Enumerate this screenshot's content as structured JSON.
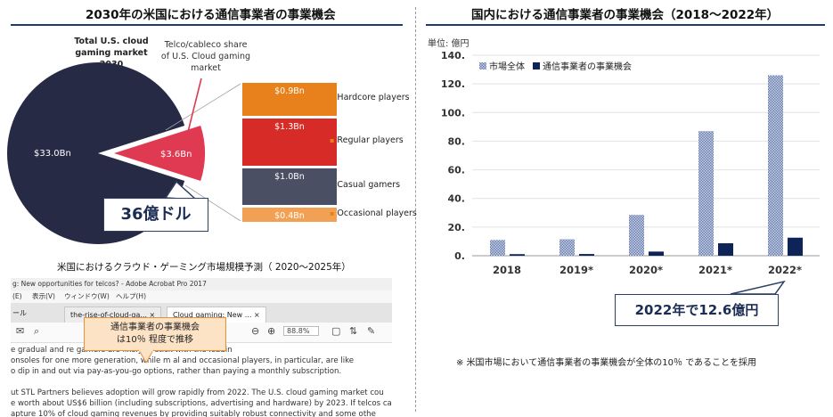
{
  "left_panel": {
    "title": "2030年の米国における通信事業者の事業機会",
    "pie_header_line1": "Total U.S. cloud",
    "pie_header_line2": "gaming market 2030",
    "share_label_line1": "Telco/cableco share",
    "share_label_line2": "of U.S. Cloud gaming",
    "share_label_line3": "market",
    "callout": "36億ドル"
  },
  "screenshot": {
    "title_bar": "g: New opportunities for telcos? - Adobe Acrobat Pro 2017",
    "menu": [
      "(E)",
      "表示(V)",
      "ウィンドウ(W)",
      "ヘルプ(H)"
    ],
    "tab_left": "ール",
    "tabs": [
      "the-rise-of-cloud-ga...",
      "Cloud gaming: New ..."
    ],
    "zoom": "88.8%",
    "body_lines": [
      "e gradual and                                    re gamers are likely to stick with the leadin",
      "onsoles for one more generation, while m          al and occasional players, in particular, are like",
      "o dip in and out via pay-as-you-go options, rather than paying a monthly subscription.",
      "",
      "ut STL Partners believes adoption will grow rapidly from 2022. The U.S. cloud gaming market cou",
      "e worth about US$6 billion (including subscriptions, advertising and hardware) by 2023. If telcos ca",
      "apture 10% of cloud gaming revenues by providing suitably robust connectivity and some othe"
    ],
    "caption": "米国におけるクラウド・ゲーミング市場規模予測（ 2020～2025年）",
    "orange_callout_line1": "通信事業者の事業機会",
    "orange_callout_line2": "は10％ 程度で推移"
  },
  "right_panel": {
    "title": "国内における通信事業者の事業機会（2018～2022年）",
    "unit": "単位: 億円",
    "callout": "2022年で12.6億円",
    "note": "※ 米国市場において通信事業者の事業機会が全体の10％ であることを採用"
  },
  "colors": {
    "pie_dark": "#272a44",
    "pie_red": "#e03a52",
    "hardcore": "#e8811c",
    "regular": "#d62b27",
    "casual": "#4a4f63",
    "occasional": "#f2a154",
    "market_bar": "#8a9bc4",
    "telco_bar": "#0e2459",
    "title_underline": "#1f3b70"
  },
  "chart_data": [
    {
      "type": "pie",
      "title": "Total U.S. cloud gaming market 2030",
      "slices": [
        {
          "label": "$33.0Bn",
          "value": 33.0
        },
        {
          "label": "$3.6Bn",
          "value": 3.6
        }
      ]
    },
    {
      "type": "bar",
      "title": "Telco/cableco share of U.S. Cloud gaming market",
      "stacked": true,
      "categories": [
        "Hardcore players",
        "Regular players",
        "Casual gamers",
        "Occasional players"
      ],
      "values": [
        0.9,
        1.3,
        1.0,
        0.4
      ],
      "labels": [
        "$0.9Bn",
        "$1.3Bn",
        "$1.0Bn",
        "$0.4Bn"
      ]
    },
    {
      "type": "bar",
      "title": "国内における通信事業者の事業機会（2018～2022年）",
      "ylabel": "単位: 億円",
      "categories": [
        "2018",
        "2019*",
        "2020*",
        "2021*",
        "2022*"
      ],
      "ylim": [
        0,
        140
      ],
      "yticks": [
        0,
        20,
        40,
        60,
        80,
        100,
        120,
        140
      ],
      "ytick_labels": [
        "0.",
        "20.",
        "40.",
        "60.",
        "80.",
        "100.",
        "120.",
        "140."
      ],
      "legend_position": "top-left",
      "grid": true,
      "series": [
        {
          "name": "市場全体",
          "values": [
            11,
            11.5,
            28.5,
            87,
            126
          ]
        },
        {
          "name": "通信事業者の事業機会",
          "values": [
            1.1,
            1.2,
            2.9,
            8.7,
            12.6
          ]
        }
      ]
    }
  ]
}
